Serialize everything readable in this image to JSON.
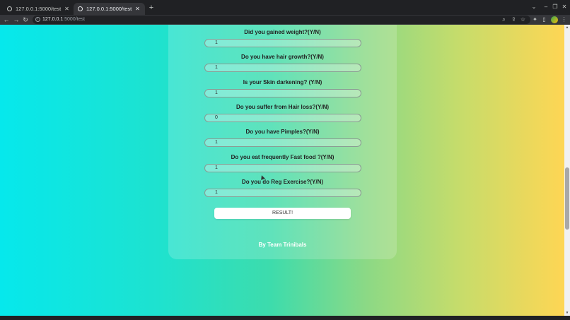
{
  "browser": {
    "tabs": [
      {
        "title": "127.0.0.1:5000/test",
        "active": false
      },
      {
        "title": "127.0.0.1:5000/test",
        "active": true
      }
    ],
    "new_tab_icon": "+",
    "url_host": "127.0.0.1",
    "url_rest": ":5000/test",
    "window_controls": [
      "chevron-down",
      "minimize",
      "restore",
      "close"
    ]
  },
  "form": {
    "questions": [
      {
        "label": "Did you gained weight?(Y/N)",
        "value": "1"
      },
      {
        "label": "Do you have hair growth?(Y/N)",
        "value": "1"
      },
      {
        "label": "Is your Skin darkening? (Y/N)",
        "value": "1"
      },
      {
        "label": "Do you suffer from Hair loss?(Y/N)",
        "value": "0"
      },
      {
        "label": "Do you have Pimples?(Y/N)",
        "value": "1"
      },
      {
        "label": "Do you eat frequently Fast food ?(Y/N)",
        "value": "1"
      },
      {
        "label": "Do you do Reg Exercise?(Y/N)",
        "value": "1"
      }
    ],
    "submit_label": "RESULT!"
  },
  "footer": {
    "text": "By Team Trinibals"
  },
  "colors": {
    "gradient_left": "#06e8ec",
    "gradient_mid": "#3ddcac",
    "gradient_right": "#fed654"
  }
}
